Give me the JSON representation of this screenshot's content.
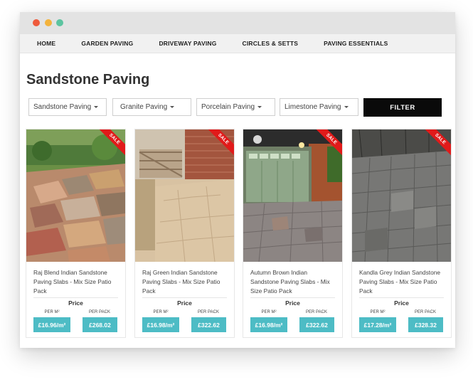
{
  "nav": {
    "items": [
      "HOME",
      "GARDEN PAVING",
      "DRIVEWAY PAVING",
      "CIRCLES & SETTS",
      "PAVING ESSENTIALS"
    ]
  },
  "page": {
    "title": "Sandstone Paving"
  },
  "filters": {
    "selects": [
      "Sandstone Paving",
      "Granite Paving",
      "Porcelain Paving",
      "Limestone Paving"
    ],
    "button": "FILTER"
  },
  "price_labels": {
    "heading": "Price",
    "per_m2": "PER M²",
    "per_pack": "PER PACK"
  },
  "sale_badge": "SALE",
  "products": [
    {
      "name": "Raj Blend Indian Sandstone Paving Slabs - Mix Size Patio Pack",
      "price_m2": "£16.96/m²",
      "price_pack": "£268.02"
    },
    {
      "name": "Raj Green Indian Sandstone Paving Slabs - Mix Size Patio Pack",
      "price_m2": "£16.98/m²",
      "price_pack": "£322.62"
    },
    {
      "name": "Autumn Brown Indian Sandstone Paving Slabs - Mix Size Patio Pack",
      "price_m2": "£16.98/m²",
      "price_pack": "£322.62"
    },
    {
      "name": "Kandla Grey Indian Sandstone Paving Slabs - Mix Size Patio Pack",
      "price_m2": "£17.28/m²",
      "price_pack": "£328.32"
    }
  ],
  "colors": {
    "accent": "#4dbcc5",
    "sale": "#e11a1a",
    "filter_button": "#0a0a0a"
  }
}
